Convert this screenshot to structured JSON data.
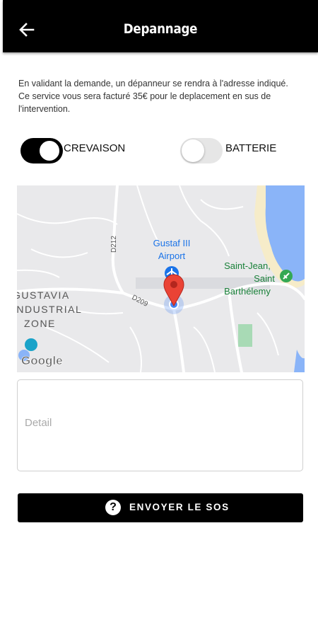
{
  "header": {
    "title": "Depannage",
    "back_icon": "arrow-left-icon"
  },
  "info_text": "En validant la demande, un dépanneur se rendra à l'adresse indiqué. Ce service vous sera facturé 35€ pour le deplacement en sus de l'intervention.",
  "options": [
    {
      "label": "CREVAISON",
      "selected": true
    },
    {
      "label": "BATTERIE",
      "selected": false
    }
  ],
  "map": {
    "labels": {
      "airport_line1": "Gustaf III",
      "airport_line2": "Airport",
      "place_line1": "Saint-Jean,",
      "place_line2": "Saint",
      "place_line3": "Barthélemy",
      "zone_line1": "GUSTAVIA",
      "zone_line2": "INDUSTRIAL",
      "zone_line3": "ZONE",
      "road_d209": "D209",
      "road_d212": "D212",
      "logo": "Google"
    },
    "colors": {
      "land": "#e9e9eb",
      "water": "#8ab4f8",
      "beach": "#f6ecc9",
      "park": "#a8dab5",
      "pin": "#ea4335",
      "airport_label": "#1a73e8",
      "place_label": "#188038"
    }
  },
  "detail": {
    "placeholder": "Detail",
    "value": ""
  },
  "sos_button": {
    "label": "ENVOYER LE SOS",
    "icon": "question-circle-icon"
  }
}
